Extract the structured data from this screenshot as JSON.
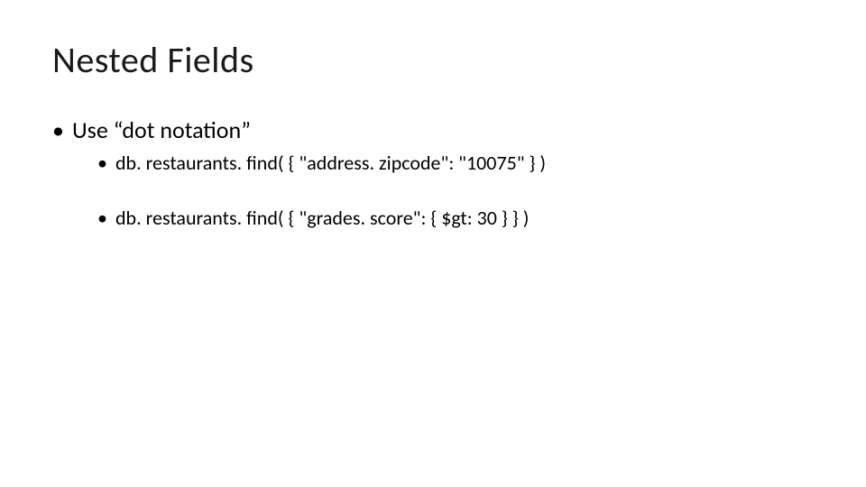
{
  "slide": {
    "title": "Nested Fields",
    "bullets": [
      {
        "text": "Use “dot notation”",
        "sub": [
          "db. restaurants. find( { \"address. zipcode\": \"10075\" } )",
          "db. restaurants. find( { \"grades. score\": { $gt: 30 } } )"
        ]
      }
    ]
  }
}
